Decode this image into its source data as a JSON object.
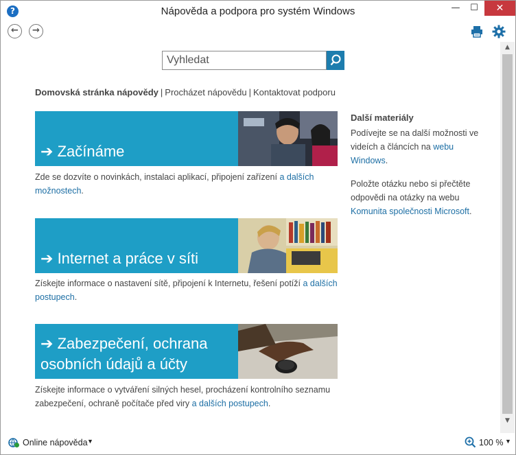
{
  "window": {
    "title": "Nápověda a podpora pro systém Windows",
    "app_icon": "?",
    "minimize": "—",
    "maximize": "☐",
    "close": "✕"
  },
  "toolbar": {
    "back": "←",
    "forward": "→"
  },
  "search": {
    "placeholder": "Vyhledat"
  },
  "breadcrumb": {
    "current": "Domovská stránka nápovědy",
    "items": [
      "Procházet nápovědu",
      "Kontaktovat podporu"
    ],
    "separator": "|"
  },
  "tiles": [
    {
      "title": "Začínáme",
      "desc_text": "Zde se dozvíte o novinkách, instalaci aplikací, připojení zařízení ",
      "desc_link": "a dalších možnostech",
      "desc_end": "."
    },
    {
      "title": "Internet a práce v síti",
      "desc_text": "Získejte informace o nastavení sítě, připojení k Internetu, řešení potíží ",
      "desc_link": "a dalších postupech",
      "desc_end": "."
    },
    {
      "title_line1": "Zabezpečení, ochrana",
      "title_line2": "osobních údajů a účty",
      "desc_text": "Získejte informace o vytváření silných hesel, procházení kontrolního seznamu zabezpečení, ochraně počítače před viry ",
      "desc_link": "a dalších postupech",
      "desc_end": "."
    }
  ],
  "arrow": "➔",
  "side": {
    "heading": "Další materiály",
    "p1_text": "Podívejte se na další možnosti ve videích a článcích na ",
    "p1_link": "webu Windows",
    "p1_end": ".",
    "p2_text": "Položte otázku nebo si přečtěte odpovědi na otázky na webu ",
    "p2_link": "Komunita společnosti Microsoft",
    "p2_end": "."
  },
  "statusbar": {
    "online_label": "Online nápověda",
    "caret": "▼",
    "zoom": "100 %"
  },
  "colors": {
    "tile_blue": "#1e9ec6",
    "link": "#1c6ea4",
    "close_red": "#c7383e"
  }
}
